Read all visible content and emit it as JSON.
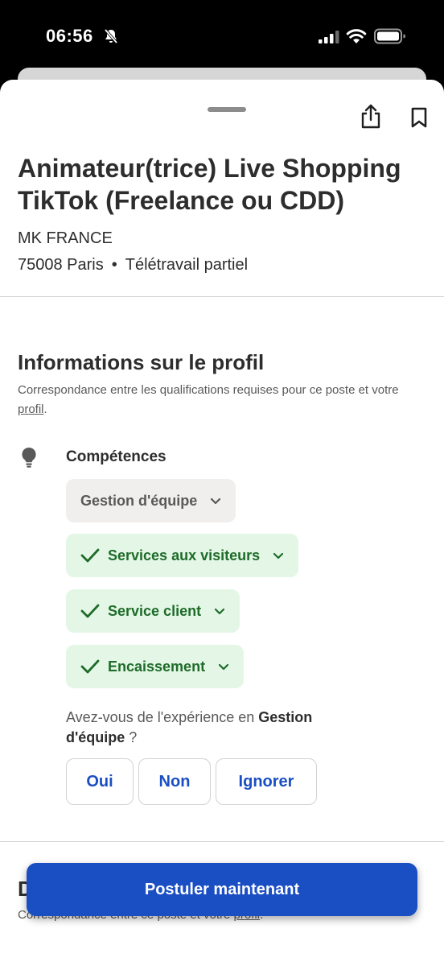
{
  "status_bar": {
    "time": "06:56"
  },
  "job": {
    "title": "Animateur(trice) Live Shopping TikTok (Freelance ou CDD)",
    "company": "MK FRANCE",
    "location": "75008 Paris",
    "separator": "•",
    "work_mode": "Télétravail partiel"
  },
  "profile": {
    "title": "Informations sur le profil",
    "desc_prefix": "Correspondance entre les qualifications requises pour ce poste et votre ",
    "desc_link": "profil",
    "desc_suffix": ".",
    "skills_label": "Compétences",
    "skills": [
      {
        "label": "Gestion d'équipe",
        "matched": false
      },
      {
        "label": "Services aux visiteurs",
        "matched": true
      },
      {
        "label": "Service client",
        "matched": true
      },
      {
        "label": "Encaissement",
        "matched": true
      }
    ],
    "question_prefix": "Avez-vous de l'expérience en ",
    "question_skill": "Gestion d'équipe",
    "question_suffix": " ?",
    "answers": {
      "yes": "Oui",
      "no": "Non",
      "skip": "Ignorer"
    }
  },
  "next_section": {
    "title_partial": "D",
    "desc_prefix": "Correspondance entre ce poste et votre ",
    "desc_link": "profil",
    "desc_suffix": "."
  },
  "apply_label": "Postuler maintenant",
  "colors": {
    "primary": "#1a4fc4",
    "match_bg": "#e4f7e6",
    "match_text": "#1e6b2a",
    "chip_grey": "#f0efed"
  },
  "icons": [
    "bell-off-icon",
    "signal-icon",
    "wifi-icon",
    "battery-icon",
    "share-icon",
    "bookmark-icon",
    "lightbulb-icon",
    "check-icon",
    "chevron-down-icon"
  ]
}
